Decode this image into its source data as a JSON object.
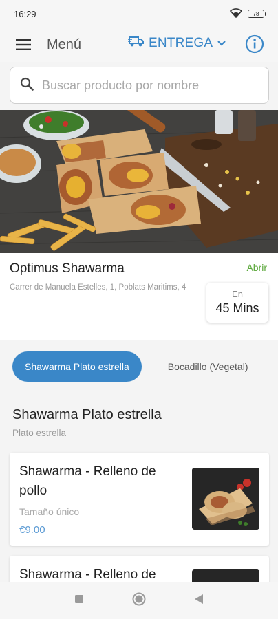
{
  "status_bar": {
    "time": "16:29",
    "battery": "78"
  },
  "header": {
    "menu_label": "Menú",
    "delivery_mode": "ENTREGA"
  },
  "search": {
    "placeholder": "Buscar producto por nombre"
  },
  "store": {
    "name": "Optimus Shawarma",
    "status": "Abrir",
    "address": "Carrer de Manuela Estelles, 1, Poblats Maritims, 4",
    "eta_label": "En",
    "eta_value": "45 Mins"
  },
  "categories": [
    {
      "label": "Shawarma Plato estrella",
      "active": true
    },
    {
      "label": "Bocadillo (Vegetal)",
      "active": false
    }
  ],
  "section": {
    "title": "Shawarma Plato estrella",
    "subtitle": "Plato estrella"
  },
  "products": [
    {
      "name": "Shawarma - Relleno de pollo",
      "size": "Tamaño único",
      "price": "€9.00"
    },
    {
      "name": "Shawarma - Relleno de"
    }
  ],
  "colors": {
    "accent": "#3a87c8",
    "open_status": "#5ba83b",
    "price": "#5a9ad4"
  },
  "icons": [
    "hamburger-menu-icon",
    "delivery-truck-icon",
    "chevron-down-icon",
    "info-icon",
    "search-icon",
    "wifi-icon",
    "battery-icon",
    "nav-recents-icon",
    "nav-home-icon",
    "nav-back-icon"
  ]
}
